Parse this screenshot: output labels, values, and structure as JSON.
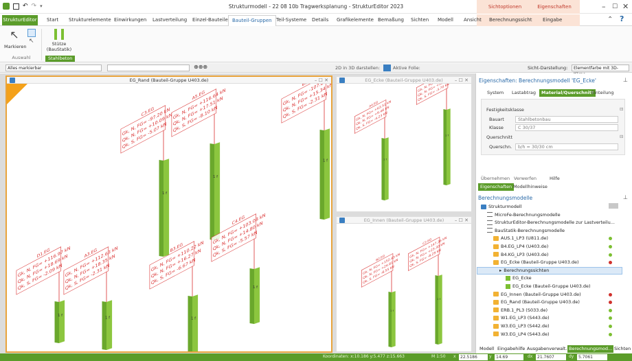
{
  "window": {
    "title": "Strukturmodell - 22 08 10b Tragwerksplanung - StrukturEditor 2023",
    "contexts": [
      "Sichtoptionen",
      "Eigenschaften"
    ]
  },
  "tabs": [
    "StrukturEditor",
    "Start",
    "Strukturelemente",
    "Einwirkungen",
    "Lastverteilung",
    "Einzel-Bauteile",
    "Bauteil-Gruppen",
    "Teil-Systeme",
    "Details",
    "Grafikelemente",
    "Bemaßung",
    "Sichten",
    "Modell",
    "Ansicht",
    "Berechnungssicht",
    "Eingabe"
  ],
  "ribbon": {
    "markieren": "Markieren",
    "stuetze_line1": "Stütze",
    "stuetze_line2": "(BauStatik)",
    "group_auswahl": "Auswahl",
    "group_stahlbeton": "Stahlbeton"
  },
  "toolbar": {
    "filter": "Alles markierbar",
    "show3d": "2D in 3D darstellen:",
    "active_foil": "Aktive Folie:",
    "view_mode_label": "Sicht-Darstellung:",
    "view_mode": "Elementfarbe mit 3D-Körpe"
  },
  "views": [
    {
      "title": "EG_Rand (Bauteil-Gruppe U403.de)"
    },
    {
      "title": "EG_Ecke (Bauteil-Gruppe U403.de)"
    },
    {
      "title": "EG_Innen (Bauteil-Gruppe U403.de)"
    }
  ],
  "model": {
    "labels_main": [
      {
        "name": "C3.EG",
        "lines": [
          "Gk, N, FG= -97.20 kN",
          "Qk, N, FG= +10.09 kN",
          "Qk, S, FG= -5.07 kN"
        ]
      },
      {
        "name": "A5.EG",
        "lines": [
          "Gk, N, FG= +116.64 kN",
          "Qk, N, FG= +17.51 kN",
          "Qk, S, FG= -8.10 kN"
        ]
      },
      {
        "name": "B1.EG",
        "lines": [
          "Gk, N, FG= -107.82 kN",
          "Qk, N, FG= +15.34 kN",
          "Qk, S, FG= -2.31 kN"
        ]
      },
      {
        "name": "D1.EG",
        "lines": [
          "Gk, N, FG= +116.97 kN",
          "Qk, N, FG= +18.69 kN",
          "Qk, S, FG= -2.09 kN"
        ]
      },
      {
        "name": "A3.EG",
        "lines": [
          "Gk, N, FG= +112.63 kN",
          "Qk, N, FG= +18.35 kN",
          "Qk, S, FG= -2.31 kN"
        ]
      },
      {
        "name": "B3.EG",
        "lines": [
          "Gk, N, FG= +110.22 kN",
          "Qk, N, FG= +16.27 kN",
          "Qk, S, FG= -6.67 kN"
        ]
      },
      {
        "name": "C4.EG",
        "lines": [
          "Gk, N, FG= +103.08 kN",
          "Qk, N, FG= +14.80 kN",
          "Qk, S, FG= -5.57 kN"
        ]
      }
    ],
    "labels_ecke": [
      {
        "name": "A4.EG",
        "lines": [
          "Gk, N, FG= +63.51 kN",
          "Qk, N, FG= +9.48 kN",
          "Qk, S, FG= -4.23 kN"
        ]
      },
      {
        "name": "D4.EG",
        "lines": [
          "Gk, N, FG= +66.22 kN",
          "Qk, N, FG= +10.14 kN",
          "Qk, S, FG= -3.70 kN"
        ]
      }
    ],
    "labels_innen": [
      {
        "name": "B2.EG",
        "lines": [
          "Gk, N, FG= +152.43 kN",
          "Qk, N, FG= +24.81 kN",
          "Qk, S, FG= -8.55 kN"
        ]
      },
      {
        "name": "C2.EG",
        "lines": [
          "Gk, N, FG= +147.36 kN",
          "Qk, N, FG= +23.30 kN",
          "Qk, S, FG= -8.29 kN"
        ]
      }
    ],
    "column_caption": "1 f"
  },
  "properties": {
    "title": "Eigenschaften: Berechnungsmodell 'EG_Ecke'",
    "tabs": [
      "System",
      "Lastabtrag",
      "Material/Querschnitt",
      "Einteilung"
    ],
    "section1": "Festigkeitsklasse",
    "bauart_label": "Bauart",
    "bauart_value": "Stahlbetonbau",
    "klasse_label": "Klasse",
    "klasse_value": "C 30/37",
    "section2": "Querschnitt",
    "qs_label": "Querschn.",
    "qs_value": "b/h = 30/30 cm",
    "buttons": [
      "Übernehmen",
      "Verwerfen",
      "Hilfe"
    ],
    "lower_tabs": [
      "Eigenschaften",
      "Modellhinweise"
    ]
  },
  "berechnung": {
    "title": "Berechnungsmodelle",
    "items": [
      {
        "label": "Strukturmodell",
        "indent": 0,
        "icon": "folder"
      },
      {
        "label": "MicroFe-Berechnungsmodelle",
        "indent": 1,
        "icon": "list"
      },
      {
        "label": "StrukturEditor-Berechnungsmodelle zur Lastverteilu...",
        "indent": 1,
        "icon": "list"
      },
      {
        "label": "BauStatik-Berechnungsmodelle",
        "indent": 1,
        "icon": "list"
      },
      {
        "label": "AUS.1_LP3 (U811.de)",
        "indent": 2,
        "icon": "pos",
        "status": "#7cbf32"
      },
      {
        "label": "B4.EG_LP4 (U403.de)",
        "indent": 2,
        "icon": "pos",
        "status": "#7cbf32"
      },
      {
        "label": "B4.KG_LP3 (U403.de)",
        "indent": 2,
        "icon": "pos",
        "status": "#7cbf32"
      },
      {
        "label": "EG_Ecke (Bauteil-Gruppe U403.de)",
        "indent": 2,
        "icon": "pos",
        "status": "#d0312d"
      },
      {
        "label": "Berechnungssichten",
        "indent": 3,
        "icon": "none"
      },
      {
        "label": "EG_Ecke",
        "indent": 4,
        "icon": "view"
      },
      {
        "label": "EG_Ecke (Bauteil-Gruppe U403.de)",
        "indent": 4,
        "icon": "view"
      },
      {
        "label": "EG_Innen (Bauteil-Gruppe U403.de)",
        "indent": 2,
        "icon": "pos",
        "status": "#d0312d"
      },
      {
        "label": "EG_Rand (Bauteil-Gruppe U403.de)",
        "indent": 2,
        "icon": "pos",
        "status": "#d0312d"
      },
      {
        "label": "ERB.1_PL3 (S033.de)",
        "indent": 2,
        "icon": "pos",
        "status": "#7cbf32"
      },
      {
        "label": "W1.EG_LP3 (S443.de)",
        "indent": 2,
        "icon": "pos",
        "status": "#7cbf32"
      },
      {
        "label": "W3.EG_LP3 (S442.de)",
        "indent": 2,
        "icon": "pos",
        "status": "#7cbf32"
      },
      {
        "label": "W3.EG_LP4 (S443.de)",
        "indent": 2,
        "icon": "pos",
        "status": "#7cbf32"
      }
    ],
    "bottom_tabs": [
      "Modell",
      "Eingabehilfe",
      "Ausgabenverwalt...",
      "Berechnungsmod...",
      "Sichten"
    ]
  },
  "status": {
    "coords": "Koordinaten: x:10.186 y:5.477 z:15.663",
    "scale": "M 1:50",
    "x_label": "x",
    "x_value": "22.5186",
    "y_label": "y",
    "y_value": "14.69",
    "dx_label": "dx",
    "dx_value": "21.7607",
    "dy_label": "dy",
    "dy_value": "5.7061"
  },
  "colors": {
    "accent": "#5b9c2a",
    "frame": "#e8a33b",
    "label": "#d93030",
    "column": "#8cc63f"
  }
}
